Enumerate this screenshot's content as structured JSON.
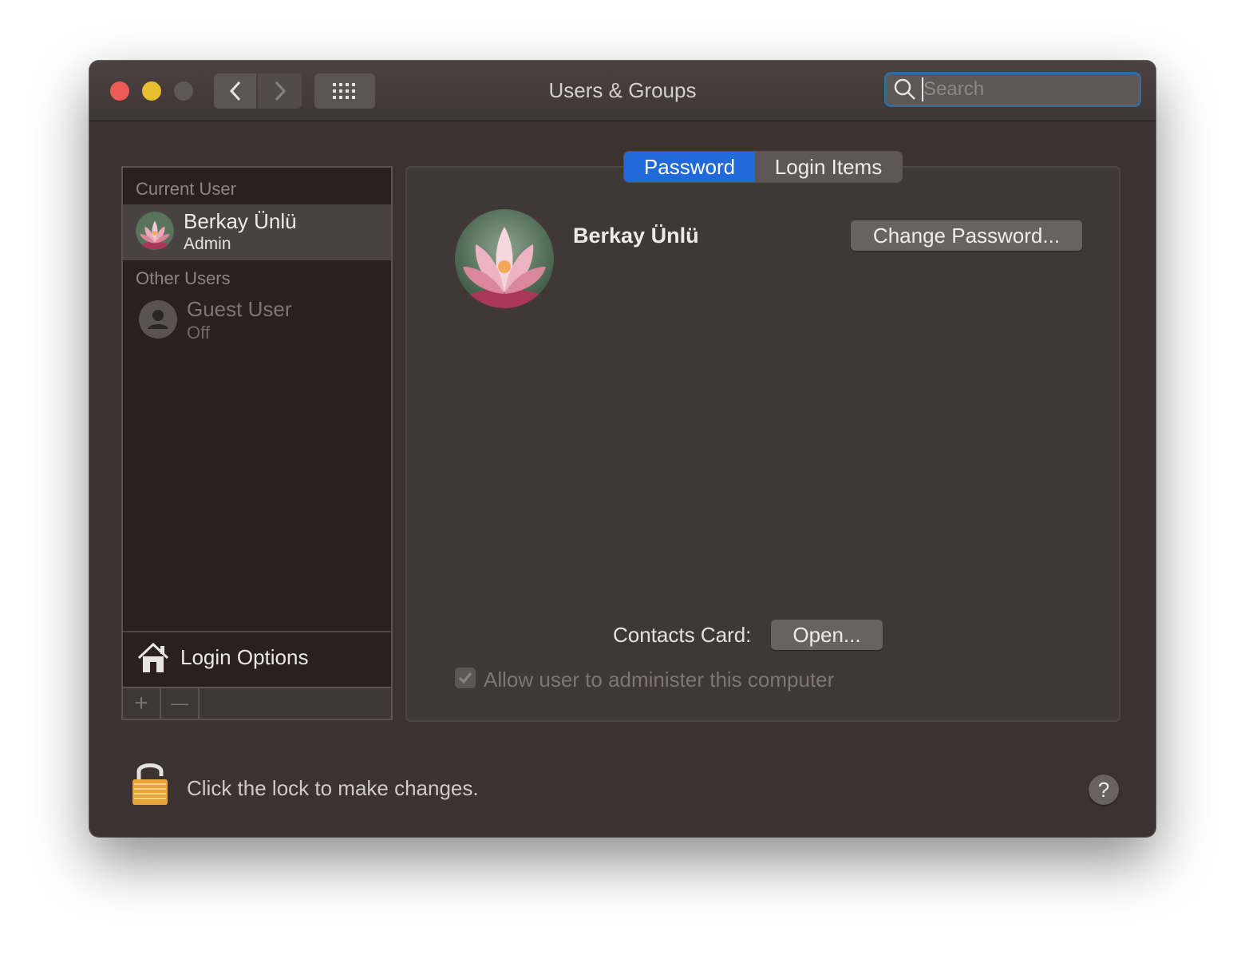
{
  "window": {
    "title": "Users & Groups",
    "search_placeholder": "Search"
  },
  "sidebar": {
    "current_user_header": "Current User",
    "current_user": {
      "name": "Berkay Ünlü",
      "role": "Admin"
    },
    "other_users_header": "Other Users",
    "other_users": [
      {
        "name": "Guest User",
        "status": "Off"
      }
    ],
    "login_options_label": "Login Options",
    "add_label": "+",
    "remove_label": "—"
  },
  "tabs": [
    {
      "label": "Password",
      "active": true
    },
    {
      "label": "Login Items",
      "active": false
    }
  ],
  "main": {
    "user_name": "Berkay Ünlü",
    "change_password_label": "Change Password...",
    "contacts_card_label": "Contacts Card:",
    "open_label": "Open...",
    "allow_admin_label": "Allow user to administer this computer",
    "allow_admin_checked": true
  },
  "footer": {
    "lock_text": "Click the lock to make changes.",
    "help_label": "?"
  },
  "colors": {
    "accent": "#1f6ad8",
    "window_bg": "#3b3231",
    "close": "#ed5b56",
    "minimize": "#e6be2f"
  }
}
